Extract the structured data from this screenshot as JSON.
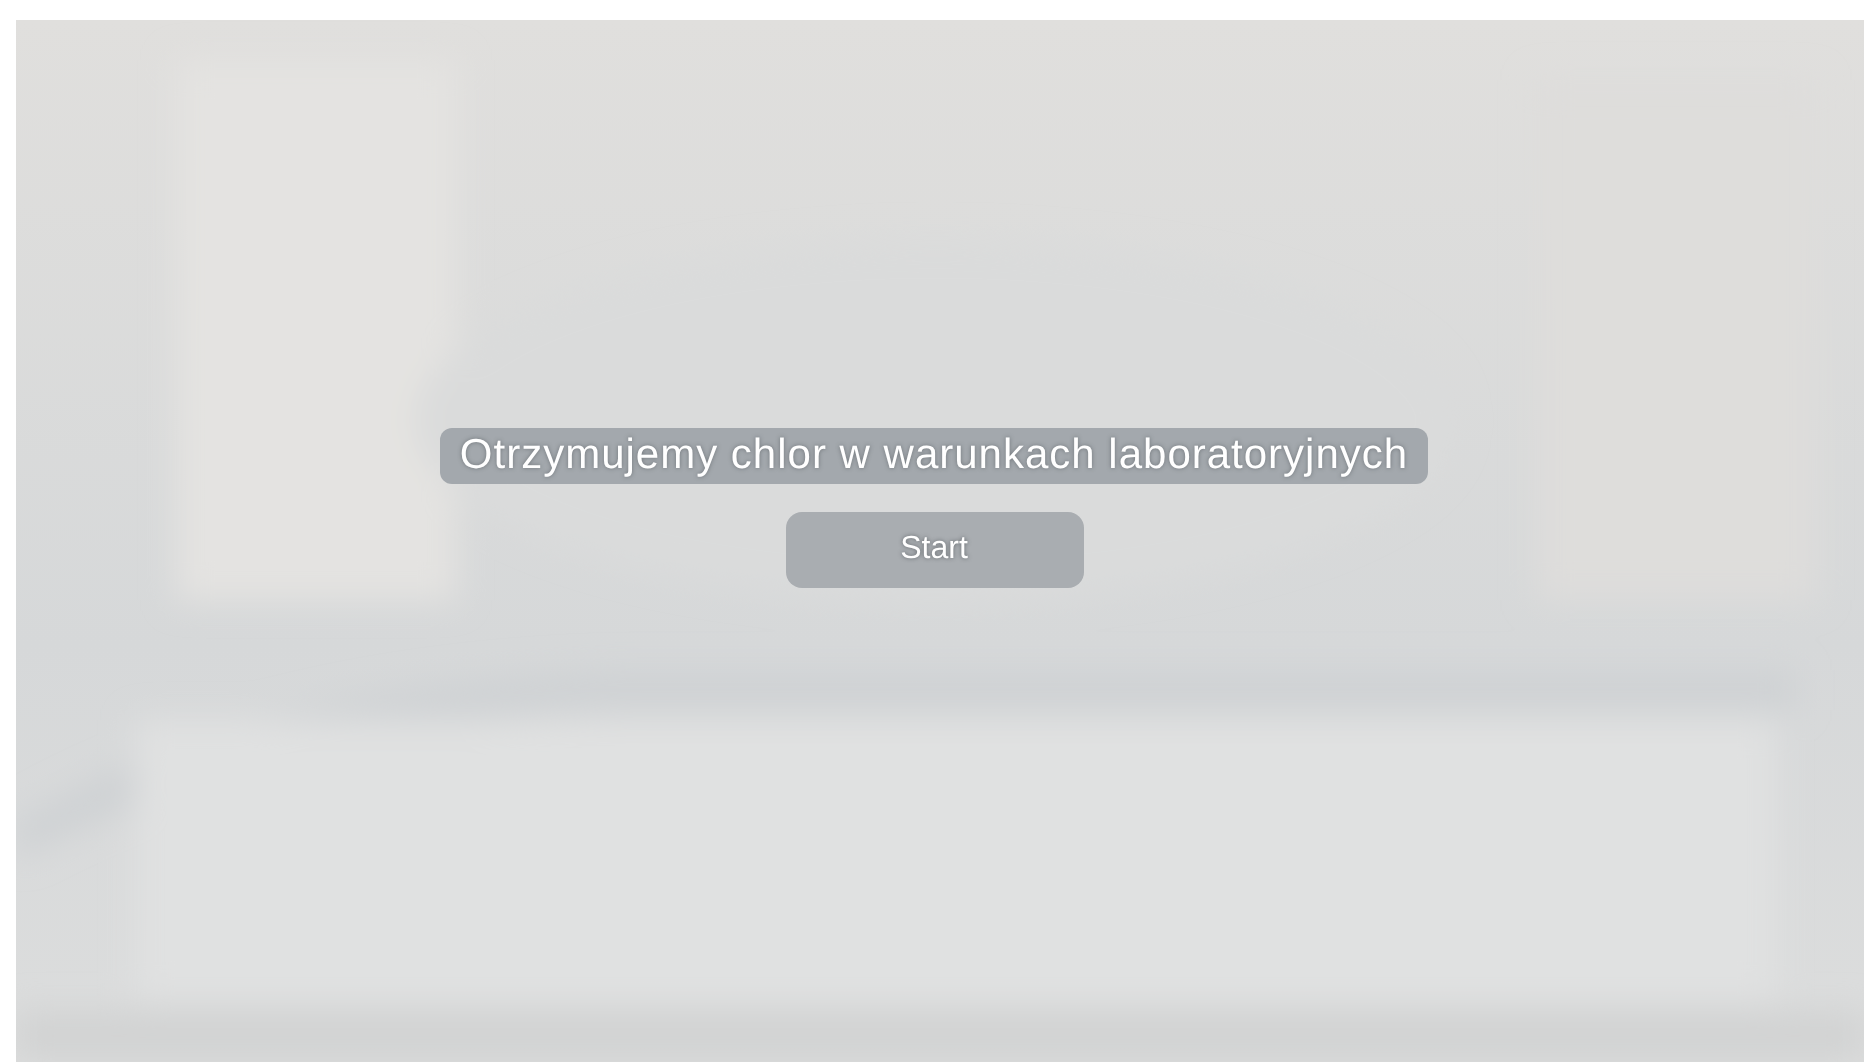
{
  "intro": {
    "title": "Otrzymujemy chlor w warunkach laboratoryjnych",
    "start_button": "Start"
  }
}
